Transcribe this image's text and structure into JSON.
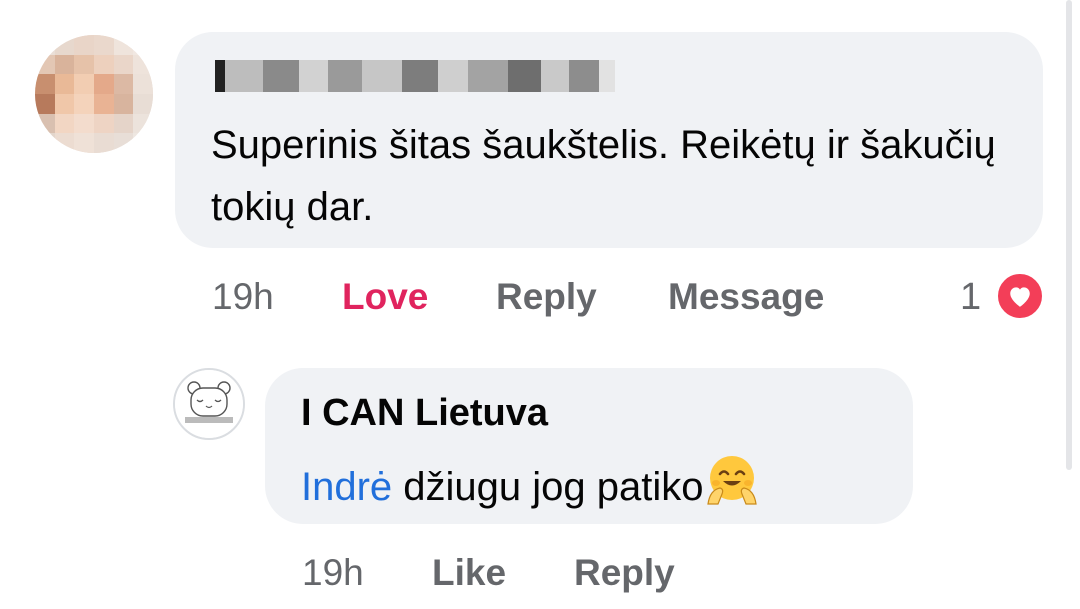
{
  "comments": [
    {
      "author": "",
      "text": "Superinis šitas šaukštelis. Reikėtų ir šakučių tokių dar.",
      "time": "19h",
      "actions": [
        "Love",
        "Reply",
        "Message"
      ],
      "reaction": {
        "count": "1",
        "type": "heart-icon"
      }
    },
    {
      "author": "I CAN Lietuva",
      "mention": "Indrė",
      "text": " džiugu jog patiko",
      "emoji": "hugging-face-icon",
      "time": "19h",
      "actions": [
        "Like",
        "Reply"
      ]
    }
  ],
  "colors": {
    "love": "#e0245e",
    "mention": "#216fdb",
    "bubble": "#f0f2f5",
    "secondary_text": "#65676b",
    "heart_badge": "#f33e58"
  }
}
